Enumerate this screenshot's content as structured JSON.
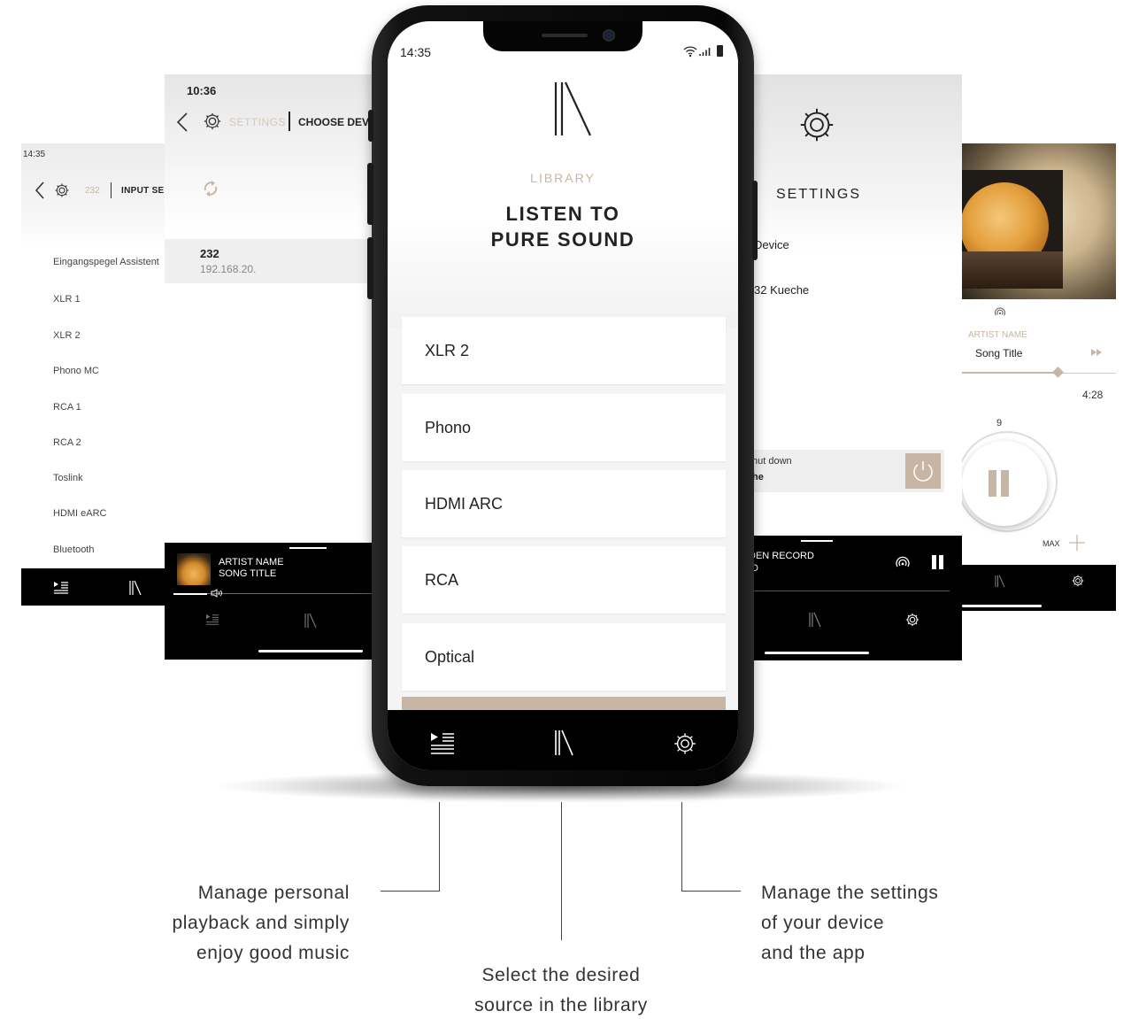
{
  "far_left": {
    "time": "14:35",
    "crumb": "232",
    "nav_title": "INPUT SE",
    "items": [
      "Eingangspegel Assistent",
      "XLR 1",
      "XLR 2",
      "Phono MC",
      "RCA 1",
      "RCA 2",
      "Toslink",
      "HDMI eARC",
      "Bluetooth"
    ]
  },
  "left": {
    "time": "10:36",
    "crumb": "SETTINGS",
    "nav_title": "CHOOSE DEV",
    "device_name": "232",
    "device_ip": "192.168.20.",
    "player_artist": "ARTIST NAME",
    "player_song": "SONG TITLE"
  },
  "phone": {
    "time": "14:35",
    "section": "LIBRARY",
    "headline_1": "LISTEN TO",
    "headline_2": "PURE SOUND",
    "sources": [
      "XLR 2",
      "Phono",
      "HDMI ARC",
      "RCA",
      "Optical"
    ]
  },
  "right": {
    "title": "SETTINGS",
    "row1": "Device",
    "row2": "32 Kueche",
    "shutdown": "hut down",
    "shutdown_sub": "he",
    "player_line1": "DEN RECORD",
    "player_line2": "ID"
  },
  "far_right": {
    "artist": "ARTIST NAME",
    "song": "Song Title",
    "duration": "4:28",
    "volume": "9",
    "max_label": "MAX",
    "progress": 0.62
  },
  "captions": {
    "left": [
      "Manage personal",
      "playback and simply",
      "enjoy good music"
    ],
    "center": [
      "Select the desired",
      "source in the library"
    ],
    "right": [
      "Manage the settings",
      "of your device",
      "and the app"
    ]
  },
  "colors": {
    "accent": "#c6b6a3",
    "bar": "#000000"
  }
}
